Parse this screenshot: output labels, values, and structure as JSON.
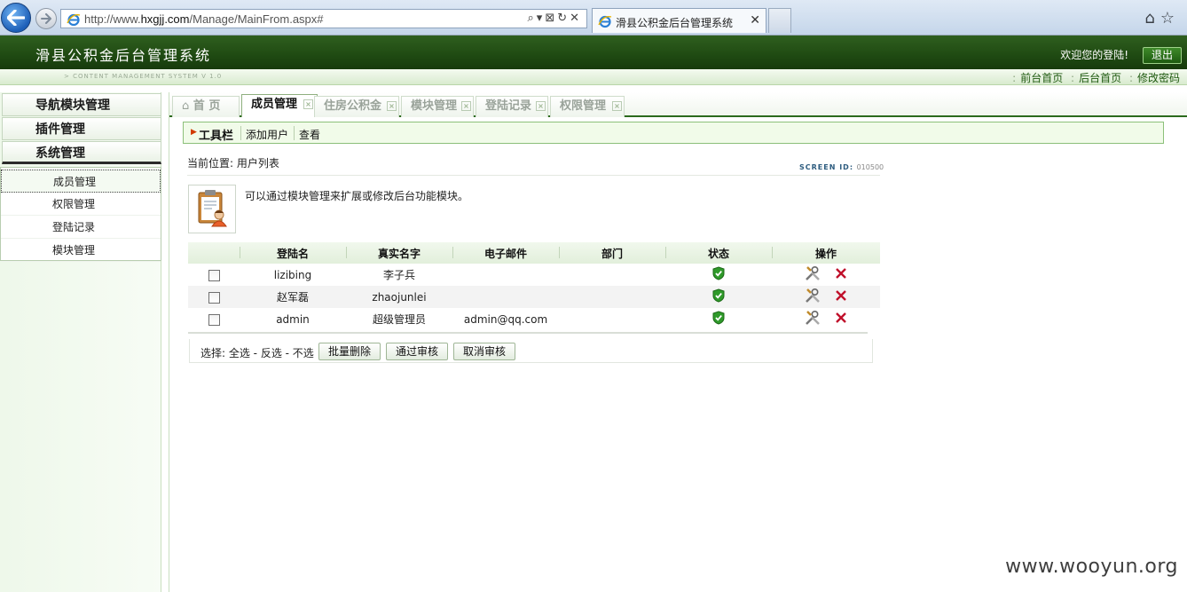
{
  "browser": {
    "url_prefix": "http://www.",
    "url_domain": "hxgjj.com",
    "url_path": "/Manage/MainFrom.aspx#",
    "tab_title": "滑县公积金后台管理系统",
    "address_tools": "⌕▾⊠↻✕"
  },
  "header": {
    "title": "滑县公积金后台管理系统",
    "subtitle": "> CONTENT MANAGEMENT SYSTEM V 1.0",
    "welcome": "欢迎您的登陆!",
    "logout_label": "退出",
    "links": [
      "前台首页",
      "后台首页",
      "修改密码"
    ]
  },
  "sidebar": {
    "headers": [
      "导航模块管理",
      "插件管理",
      "系统管理"
    ],
    "items": [
      "成员管理",
      "权限管理",
      "登陆记录",
      "模块管理"
    ]
  },
  "tabs": [
    {
      "label": "首 页",
      "active": false
    },
    {
      "label": "成员管理",
      "active": true
    },
    {
      "label": "住房公积金",
      "active": false
    },
    {
      "label": "模块管理",
      "active": false
    },
    {
      "label": "登陆记录",
      "active": false
    },
    {
      "label": "权限管理",
      "active": false
    }
  ],
  "toolbar": {
    "label": "工具栏",
    "buttons": [
      "添加用户",
      "查看"
    ]
  },
  "location": {
    "text": "当前位置: 用户列表",
    "screen_id_label": "SCREEN ID:",
    "screen_id_value": "010500"
  },
  "info": {
    "text": "可以通过模块管理来扩展或修改后台功能模块。"
  },
  "table": {
    "headers": [
      "",
      "登陆名",
      "真实名字",
      "电子邮件",
      "部门",
      "状态",
      "操作"
    ],
    "rows": [
      {
        "login": "lizibing",
        "real_name": "李子兵",
        "email": "",
        "dept": ""
      },
      {
        "login": "赵军磊",
        "real_name": "zhaojunlei",
        "email": "",
        "dept": ""
      },
      {
        "login": "admin",
        "real_name": "超级管理员",
        "email": "admin@qq.com",
        "dept": ""
      }
    ]
  },
  "footer": {
    "select_text": "选择: 全选 - 反选 - 不选",
    "buttons": [
      "批量删除",
      "通过审核",
      "取消审核"
    ]
  },
  "watermark": "www.wooyun.org",
  "colors": {
    "header_green": "#1f4a12",
    "accent_green": "#2b6a1c",
    "delete_red": "#c0102a"
  }
}
